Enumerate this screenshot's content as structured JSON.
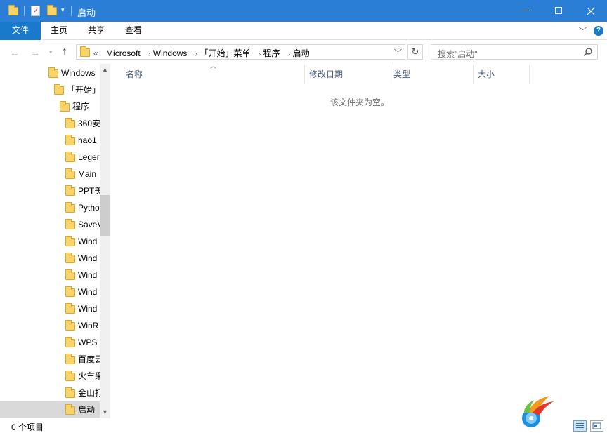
{
  "window": {
    "title": "启动",
    "controls": {
      "minimize": "minimize-icon",
      "maximize": "maximize-icon",
      "close": "close-icon"
    }
  },
  "ribbon": {
    "file_tab": "文件",
    "tabs": [
      "主页",
      "共享",
      "查看"
    ]
  },
  "address": {
    "overflow": "«",
    "crumbs": [
      "Microsoft",
      "Windows",
      "「开始」菜单",
      "程序",
      "启动"
    ]
  },
  "search": {
    "placeholder": "搜索\"启动\""
  },
  "nav_tree": [
    {
      "label": "Windows",
      "level": 0
    },
    {
      "label": "「开始」",
      "level": 1
    },
    {
      "label": "程序",
      "level": 2
    },
    {
      "label": "360安",
      "level": 3
    },
    {
      "label": "hao1",
      "level": 3
    },
    {
      "label": "Leger",
      "level": 3
    },
    {
      "label": "Main",
      "level": 3
    },
    {
      "label": "PPT美",
      "level": 3
    },
    {
      "label": "Pytho",
      "level": 3
    },
    {
      "label": "SaveV",
      "level": 3
    },
    {
      "label": "Wind",
      "level": 3
    },
    {
      "label": "Wind",
      "level": 3
    },
    {
      "label": "Wind",
      "level": 3
    },
    {
      "label": "Wind",
      "level": 3
    },
    {
      "label": "Wind",
      "level": 3
    },
    {
      "label": "WinR",
      "level": 3
    },
    {
      "label": "WPS",
      "level": 3
    },
    {
      "label": "百度云",
      "level": 3
    },
    {
      "label": "火车采",
      "level": 3
    },
    {
      "label": "金山打",
      "level": 3
    },
    {
      "label": "启动",
      "level": 3,
      "selected": true
    }
  ],
  "columns": {
    "name": "名称",
    "modified": "修改日期",
    "type": "类型",
    "size": "大小"
  },
  "empty_message": "该文件夹为空。",
  "status": {
    "item_count": "0 个项目"
  },
  "colors": {
    "titlebar": "#2b7ed6",
    "file_tab": "#1979ca",
    "folder": "#f8d36a",
    "column_header_text": "#4c607a",
    "selected_tree": "#d9d9d9"
  }
}
